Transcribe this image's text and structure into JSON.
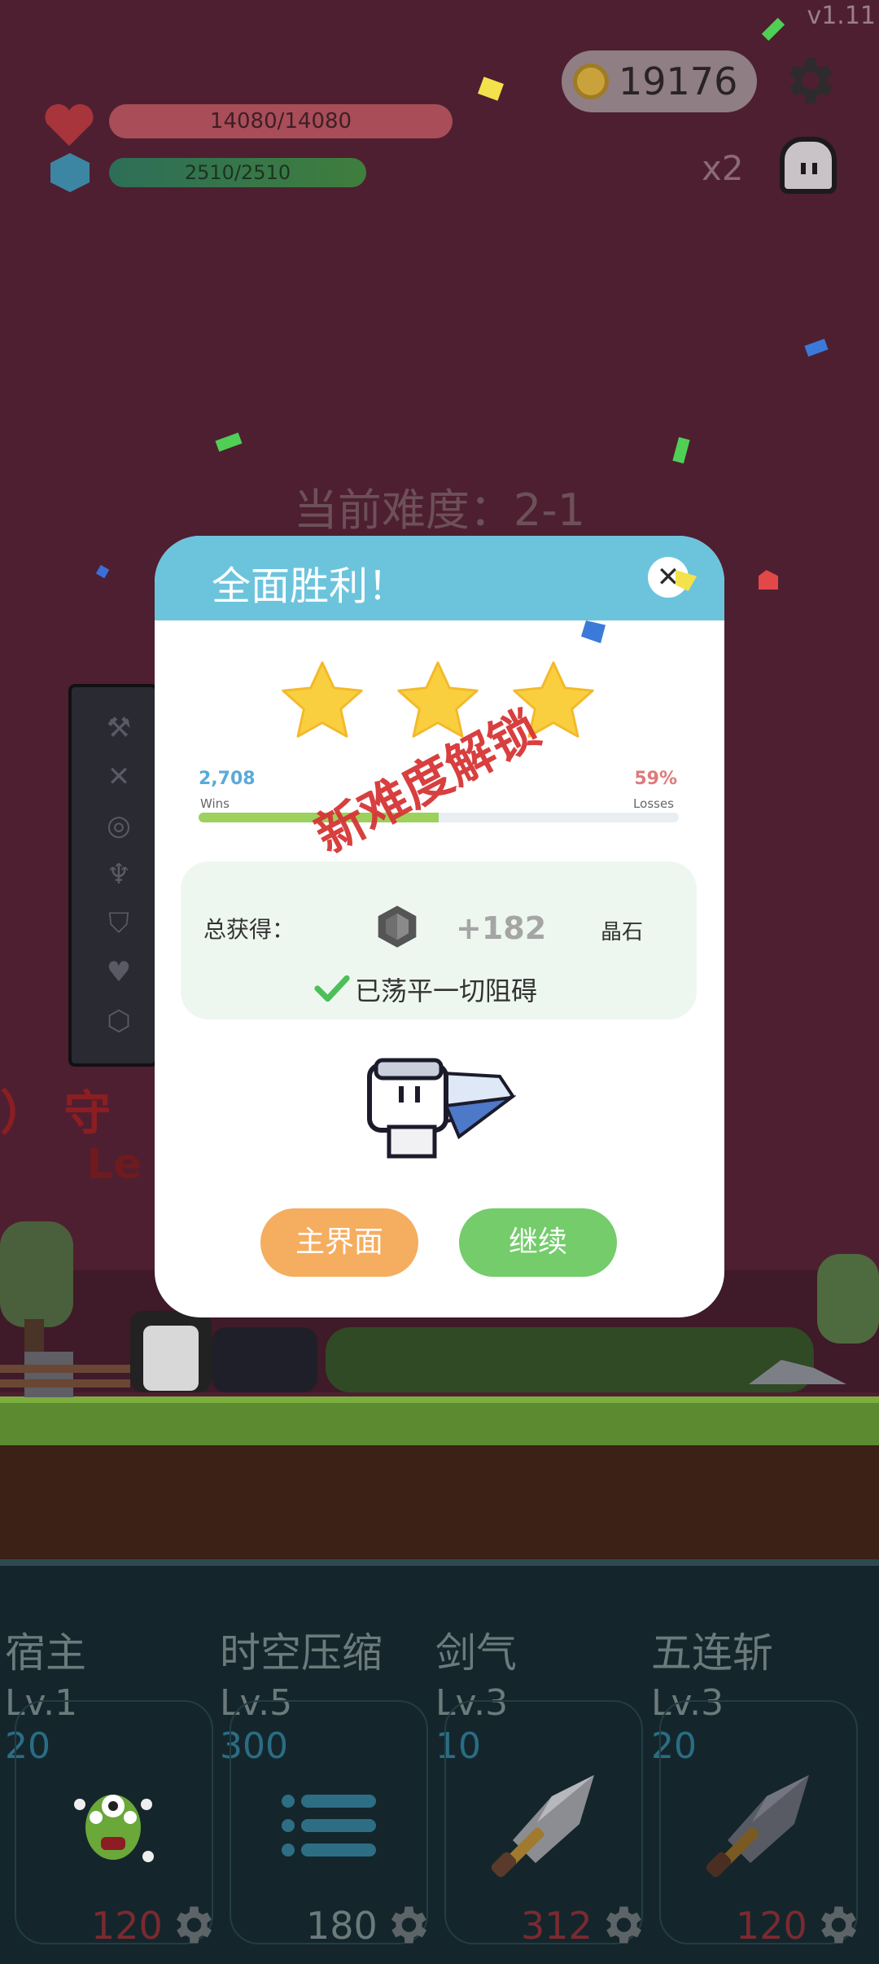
{
  "hud": {
    "version": "v1.11",
    "coins": "19176",
    "hp_text": "14080/14080",
    "hp_fraction": 1.0,
    "mp_text": "2510/2510",
    "mp_fraction": 1.0,
    "speed_label": "x2",
    "difficulty": "当前难度：2-1"
  },
  "background_text": {
    "line1": "）  守",
    "line2": "Le"
  },
  "sidebar_icons": [
    "axe-icon",
    "crossed-swords-icon",
    "target-icon",
    "horned-helmet-icon",
    "shield-icon",
    "heart-icon",
    "hexagon-gem-icon"
  ],
  "modal": {
    "title": "全面胜利！",
    "stars": 3,
    "wins_value": "2,708",
    "wins_label": "Wins",
    "losses_value": "59%",
    "losses_label": "Losses",
    "progress_fraction": 0.5,
    "reward_label": "总获得：",
    "reward_amount": "+182",
    "reward_unit": "晶石",
    "cleared_text": "已荡平一切阻碍",
    "stamp_text": "新难度解锁",
    "home_button": "主界面",
    "continue_button": "继续"
  },
  "skills": [
    {
      "name": "宿主",
      "level": "Lv.1",
      "cost": "20",
      "price": "120",
      "price_color": "#7a2a30",
      "icon": "green-monster-icon"
    },
    {
      "name": "时空压缩",
      "level": "Lv.5",
      "cost": "300",
      "price": "180",
      "price_color": "#6c7a7b",
      "icon": "list-icon"
    },
    {
      "name": "剑气",
      "level": "Lv.3",
      "cost": "10",
      "price": "312",
      "price_color": "#7a2a30",
      "icon": "sword-icon"
    },
    {
      "name": "五连斩",
      "level": "Lv.3",
      "cost": "20",
      "price": "120",
      "price_color": "#7a2a30",
      "icon": "dark-sword-icon"
    }
  ],
  "colors": {
    "header": "#6cc4dc",
    "home_button": "#f5ad5f",
    "continue_button": "#74cc6b",
    "star": "#f9cf40",
    "stamp": "#d63535"
  }
}
